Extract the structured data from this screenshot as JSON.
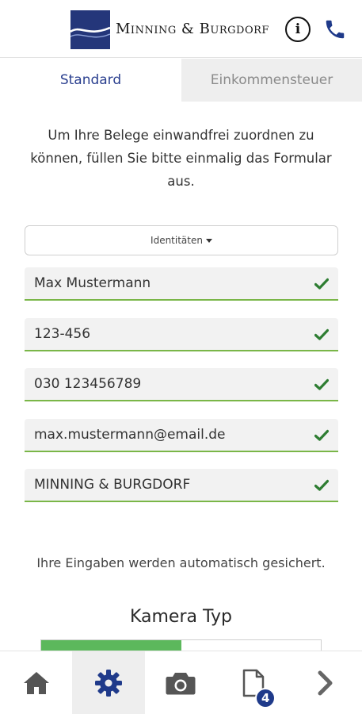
{
  "header": {
    "logo_text": "Minning & Burgdorf",
    "info_label": "i"
  },
  "tabs": [
    {
      "label": "Standard",
      "active": true
    },
    {
      "label": "Einkommensteuer",
      "active": false
    }
  ],
  "intro_text": "Um Ihre Belege einwandfrei zuordnen zu können, füllen Sie bitte einmalig das Formular aus.",
  "identity_dropdown": {
    "label": "Identitäten"
  },
  "fields": [
    {
      "value": "Max Mustermann",
      "valid": true
    },
    {
      "value": "123-456",
      "valid": true
    },
    {
      "value": "030 123456789",
      "valid": true
    },
    {
      "value": "max.mustermann@email.de",
      "valid": true
    },
    {
      "value": "MINNING & BURGDORF",
      "valid": true
    }
  ],
  "autosave_text": "Ihre Eingaben werden automatisch gesichert.",
  "camera": {
    "title": "Kamera Typ",
    "progress_fraction": 0.5
  },
  "bottom_nav": {
    "items": [
      {
        "icon": "home-icon",
        "active": false
      },
      {
        "icon": "gear-icon",
        "active": true
      },
      {
        "icon": "camera-icon",
        "active": false
      },
      {
        "icon": "document-icon",
        "active": false,
        "badge": "4"
      },
      {
        "icon": "chevron-right-icon",
        "active": false
      }
    ]
  },
  "colors": {
    "brand_blue": "#24367a",
    "accent_green": "#7ab648",
    "check_green": "#2e7d32",
    "progress_green": "#5cb85c"
  }
}
